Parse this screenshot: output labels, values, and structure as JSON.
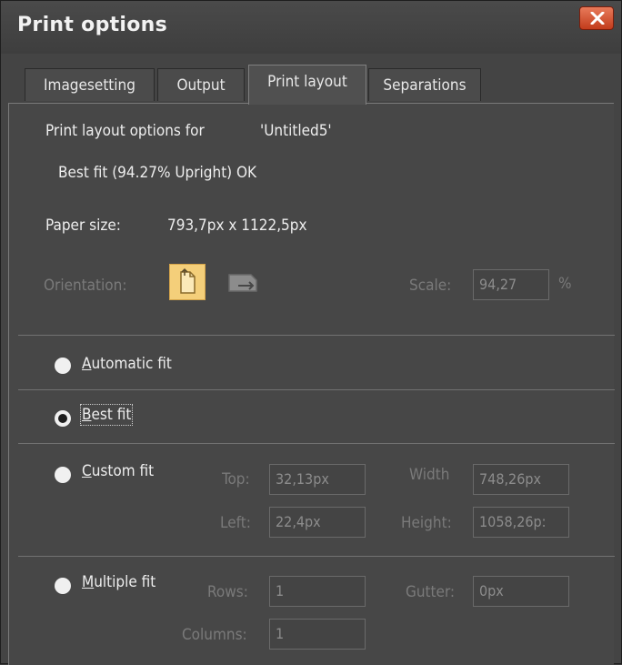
{
  "window": {
    "title": "Print options"
  },
  "tabs": [
    {
      "label": "Imagesetting"
    },
    {
      "label": "Output"
    },
    {
      "label": "Print layout"
    },
    {
      "label": "Separations"
    }
  ],
  "info": {
    "options_for_label": "Print layout options for",
    "document_name": "'Untitled5'",
    "fit_status": "Best fit (94.27% Upright) OK",
    "paper_size_label": "Paper size:",
    "paper_size_value": "793,7px x 1122,5px"
  },
  "orientation": {
    "label": "Orientation:",
    "selected": "portrait",
    "scale_label": "Scale:",
    "scale_value": "94,27",
    "scale_unit": "%"
  },
  "fit_modes": {
    "automatic": {
      "label_first": "A",
      "label_rest": "utomatic fit"
    },
    "best": {
      "label_first": "B",
      "label_rest": "est fit"
    },
    "custom": {
      "label_first": "C",
      "label_rest": "ustom fit",
      "top_label": "Top:",
      "top_value": "32,13px",
      "left_label": "Left:",
      "left_value": "22,4px",
      "width_label": "Width",
      "width_value": "748,26px",
      "height_label": "Height:",
      "height_value": "1058,26p:"
    },
    "multiple": {
      "label_first": "M",
      "label_rest": "ultiple fit",
      "rows_label": "Rows:",
      "rows_value": "1",
      "columns_label": "Columns:",
      "columns_value": "1",
      "gutter_label": "Gutter:",
      "gutter_value": "0px"
    }
  },
  "colors": {
    "background": "#444444",
    "selected_orientation": "#f4cf7a",
    "close_button": "#d04a28"
  },
  "icons": {
    "close": "close-icon",
    "portrait": "portrait-page-icon",
    "landscape": "landscape-page-icon"
  }
}
